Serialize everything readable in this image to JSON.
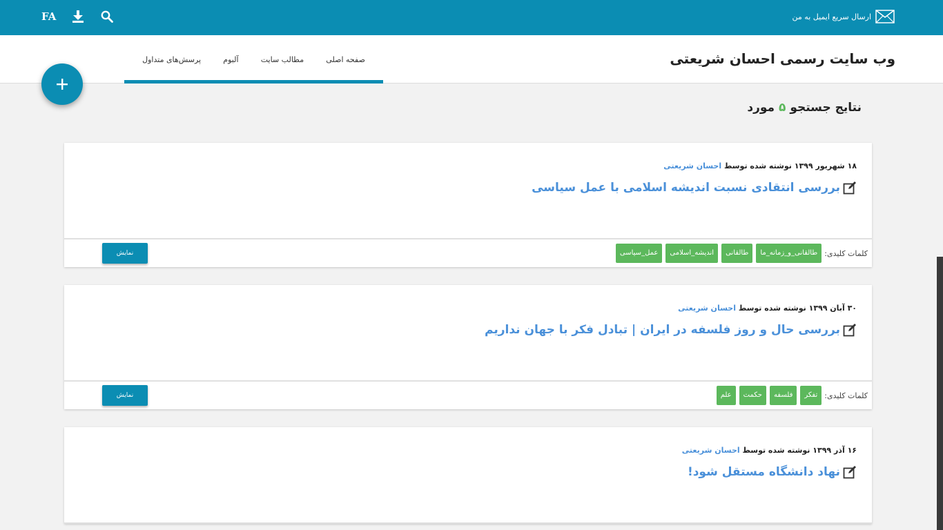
{
  "topbar": {
    "email_label": "ارسال سریع ایمیل به من",
    "lang_label": "FA",
    "icons": [
      "mail-icon",
      "download-icon",
      "search-icon"
    ]
  },
  "header": {
    "site_title": "وب سایت رسمی احسان شریعتی",
    "nav": [
      {
        "label": "صفحه اصلی"
      },
      {
        "label": "مطالب سایت"
      },
      {
        "label": "آلبوم"
      },
      {
        "label": "پرسش‌های متداول"
      }
    ]
  },
  "fab": {
    "label": "+"
  },
  "results": {
    "prefix": "نتایج جستجو",
    "count": "۵",
    "suffix": "مورد"
  },
  "common": {
    "written_by": "نوشته شده توسط",
    "keywords_label": "کلمات کلیدی:",
    "show_label": "نمایش"
  },
  "posts": [
    {
      "date": "۱۸ شهریور ۱۳۹۹",
      "author": "احسان شریعتی",
      "title": "بررسی انتقادی نسبت اندیشه اسلامی با عمل سیاسی",
      "tags": [
        "طالقانی_و_زمانه_ما",
        "طالقانی",
        "اندیشه_اسلامی",
        "عمل_سیاسی"
      ]
    },
    {
      "date": "۳۰ آبان ۱۳۹۹",
      "author": "احسان شریعتی",
      "title": "بررسی حال و روز فلسفه در ایران | تبادل فکر با جهان نداریم",
      "tags": [
        "تفکر",
        "فلسفه",
        "حکمت",
        "علم"
      ]
    },
    {
      "date": "۱۶ آذر ۱۳۹۹",
      "author": "احسان شریعتی",
      "title": "نهاد دانشگاه مستقل شود!",
      "tags": []
    }
  ],
  "colors": {
    "primary": "#0b8db3",
    "tag": "#5cb85c",
    "link": "#4a90d9",
    "background": "#f2f2f2"
  }
}
